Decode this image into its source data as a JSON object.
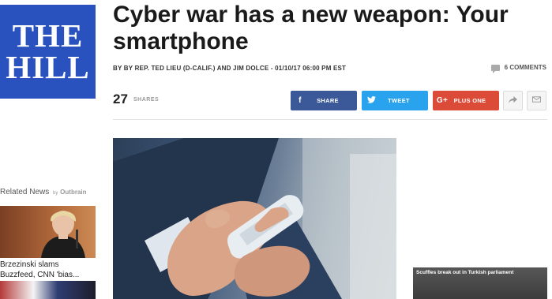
{
  "logo": {
    "line1": "THE",
    "line2": "HILL"
  },
  "article": {
    "headline": "Cyber war has a new weapon: Your smartphone",
    "byline": "BY BY REP. TED LIEU (D-CALIF.) AND JIM DOLCE - 01/10/17 06:00 PM EST",
    "comments": "6 COMMENTS"
  },
  "share": {
    "count": "27",
    "label": "SHARES",
    "facebook": "SHARE",
    "twitter": "TWEET",
    "googleplus": "PLUS ONE",
    "facebook_glyph": "f",
    "googleplus_glyph": "G+"
  },
  "related": {
    "title": "Related News",
    "by": "by",
    "provider": "Outbrain",
    "item1": "Brzezinski slams Buzzfeed, CNN 'bias..."
  },
  "video": {
    "caption": "Scuffles break out in Turkish parliament"
  },
  "colors": {
    "brand_blue": "#2a52be",
    "facebook": "#3b5998",
    "twitter": "#2aa3ef",
    "googleplus": "#dc4a38"
  }
}
